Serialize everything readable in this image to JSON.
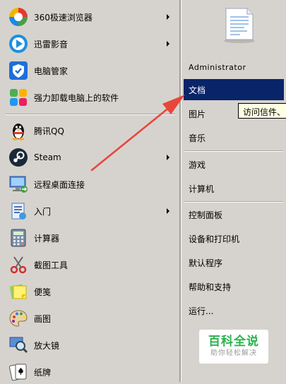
{
  "programs": [
    {
      "label": "360极速浏览器",
      "icon": "360-browser-icon",
      "has_submenu": true
    },
    {
      "label": "迅雷影音",
      "icon": "xunlei-player-icon",
      "has_submenu": true
    },
    {
      "label": "电脑管家",
      "icon": "pc-manager-icon",
      "has_submenu": false
    },
    {
      "label": "强力卸载电脑上的软件",
      "icon": "uninstaller-icon",
      "has_submenu": false
    },
    {
      "label": "腾讯QQ",
      "icon": "qq-penguin-icon",
      "has_submenu": false
    },
    {
      "label": "Steam",
      "icon": "steam-icon",
      "has_submenu": true
    },
    {
      "label": "远程桌面连接",
      "icon": "remote-desktop-icon",
      "has_submenu": false
    },
    {
      "label": "入门",
      "icon": "getting-started-icon",
      "has_submenu": true
    },
    {
      "label": "计算器",
      "icon": "calculator-icon",
      "has_submenu": false
    },
    {
      "label": "截图工具",
      "icon": "snipping-tool-icon",
      "has_submenu": false
    },
    {
      "label": "便笺",
      "icon": "sticky-notes-icon",
      "has_submenu": false
    },
    {
      "label": "画图",
      "icon": "paint-palette-icon",
      "has_submenu": false
    },
    {
      "label": "放大镜",
      "icon": "magnifier-icon",
      "has_submenu": false
    },
    {
      "label": "纸牌",
      "icon": "solitaire-cards-icon",
      "has_submenu": false
    }
  ],
  "user": {
    "name": "Administrator",
    "picture_icon": "document-user-picture-icon"
  },
  "places": [
    {
      "label": "文档",
      "selected": true
    },
    {
      "label": "图片",
      "selected": false
    },
    {
      "label": "音乐",
      "selected": false
    },
    {
      "label": "游戏",
      "selected": false
    },
    {
      "label": "计算机",
      "selected": false
    },
    {
      "label": "控制面板",
      "selected": false
    },
    {
      "label": "设备和打印机",
      "selected": false
    },
    {
      "label": "默认程序",
      "selected": false
    },
    {
      "label": "帮助和支持",
      "selected": false
    },
    {
      "label": "运行...",
      "selected": false
    }
  ],
  "tooltip": {
    "text": "访问信件、"
  },
  "watermark": {
    "title": "百科全说",
    "subtitle": "助你轻松解决"
  },
  "colors": {
    "menu_background": "#d6d3ce",
    "selection": "#0a246a",
    "tooltip_background": "#ffffe1",
    "annotation_arrow": "#e8463a",
    "watermark_green": "#2bb24c"
  }
}
